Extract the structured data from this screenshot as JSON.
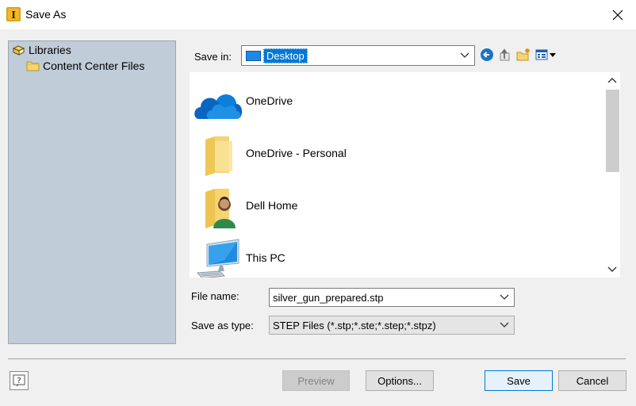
{
  "window": {
    "title": "Save As",
    "app_icon_letter": "I"
  },
  "libraries": {
    "items": [
      {
        "label": "Libraries",
        "icon": "libraries-icon"
      },
      {
        "label": "Content Center Files",
        "icon": "folder-icon"
      }
    ]
  },
  "save_in": {
    "label": "Save in:",
    "value": "Desktop"
  },
  "toolbar": {
    "icons": [
      "back-arrow-icon",
      "up-folder-icon",
      "new-folder-icon",
      "view-menu-icon"
    ]
  },
  "files": [
    {
      "name": "OneDrive",
      "icon": "onedrive-cloud-icon"
    },
    {
      "name": "OneDrive - Personal",
      "icon": "folder-icon"
    },
    {
      "name": "Dell Home",
      "icon": "user-folder-icon"
    },
    {
      "name": "This PC",
      "icon": "computer-icon"
    }
  ],
  "file_name": {
    "label": "File name:",
    "value": "silver_gun_prepared.stp"
  },
  "save_as_type": {
    "label": "Save as type:",
    "value": "STEP Files (*.stp;*.ste;*.step;*.stpz)"
  },
  "buttons": {
    "preview": "Preview",
    "options": "Options...",
    "save": "Save",
    "cancel": "Cancel"
  },
  "colors": {
    "accent": "#0078d7",
    "library_panel": "#c0ccd8",
    "folder": "#f6d472"
  }
}
